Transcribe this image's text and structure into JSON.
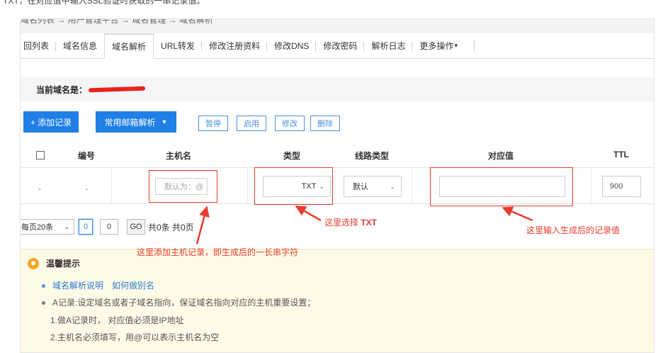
{
  "intro_text": "TXT，在对应值中输入SSL验证时获取的一串记录值。",
  "breadcrumb": "域名列表 → 用户管理平台 → 域名管理 → 域名解析",
  "tabs": [
    {
      "label": "回列表"
    },
    {
      "label": "域名信息"
    },
    {
      "label": "域名解析"
    },
    {
      "label": "URL转发"
    },
    {
      "label": "修改注册资料"
    },
    {
      "label": "修改DNS"
    },
    {
      "label": "修改密码"
    },
    {
      "label": "解析日志"
    },
    {
      "label": "更多操作"
    }
  ],
  "current_domain": {
    "label": "当前域名是："
  },
  "toolbar": {
    "add_label": "+ 添加记录",
    "mail_label": "常用邮箱解析",
    "pause_label": "暂停",
    "enable_label": "启用",
    "edit_label": "修改",
    "delete_label": "删除"
  },
  "table": {
    "headers": {
      "id": "编号",
      "host": "主机名",
      "type": "类型",
      "line": "线路类型",
      "value": "对应值",
      "ttl": "TTL"
    },
    "row": {
      "dash1": "-",
      "dash2": "-",
      "host_placeholder": "默认为：@",
      "type_value": "TXT",
      "line_value": "默认",
      "value_value": "",
      "ttl_value": "900"
    }
  },
  "pager": {
    "per_page": "每页20条",
    "current_page": "0",
    "page_input": "0",
    "go_label": "GO",
    "info": "共0条 共0页"
  },
  "tips": {
    "title": "温馨提示",
    "link1": "域名解析说明",
    "link2": "如何做别名",
    "line1": "A记录:设定域名或者子域名指向，保证域名指向对应的主机重要设置；",
    "line2": "1.做A记录时， 对应值必须是IP地址",
    "line3": "2.主机名必须填写，用@可以表示主机名为空"
  },
  "annotations": {
    "type_note_prefix": "这里选择 ",
    "type_note_value": "TXT",
    "value_note": "这里输入生成后的记录值",
    "host_note": "这里添加主机记录，即生成后的一长串字符"
  },
  "colors": {
    "primary": "#1f7fe6",
    "annotation_red": "#e63b2e",
    "tips_bg": "#fdfbe7"
  }
}
